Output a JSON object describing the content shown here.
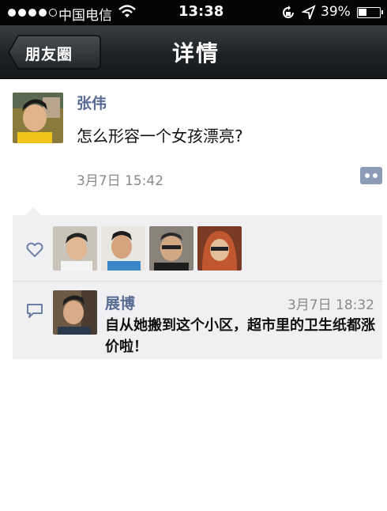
{
  "status_bar": {
    "carrier": "中国电信",
    "time": "13:38",
    "battery": "39%",
    "battery_level": 0.39,
    "signal_bars_filled": 4,
    "icons": [
      "signal-dots-icon",
      "wifi-icon",
      "rotation-lock-icon",
      "location-arrow-icon",
      "battery-icon"
    ]
  },
  "nav": {
    "back_label": "朋友圈",
    "title": "详情"
  },
  "post": {
    "author": "张伟",
    "text": "怎么形容一个女孩漂亮?",
    "time": "3月7日 15:42",
    "colors": {
      "name": "#576b95",
      "time": "#8a8a8a"
    }
  },
  "likes": {
    "icon": "heart-icon",
    "avatars": [
      "avatar-1",
      "avatar-2",
      "avatar-3",
      "avatar-4"
    ]
  },
  "comments": [
    {
      "author": "展博",
      "time": "3月7日 18:32",
      "text": "自从她搬到这个小区，超市里的卫生纸都涨价啦！"
    }
  ],
  "colors": {
    "status_bar_bg": "#050505",
    "nav_bg": "#1f2225",
    "panel_bg": "#f0f0f2",
    "link": "#576b95"
  }
}
